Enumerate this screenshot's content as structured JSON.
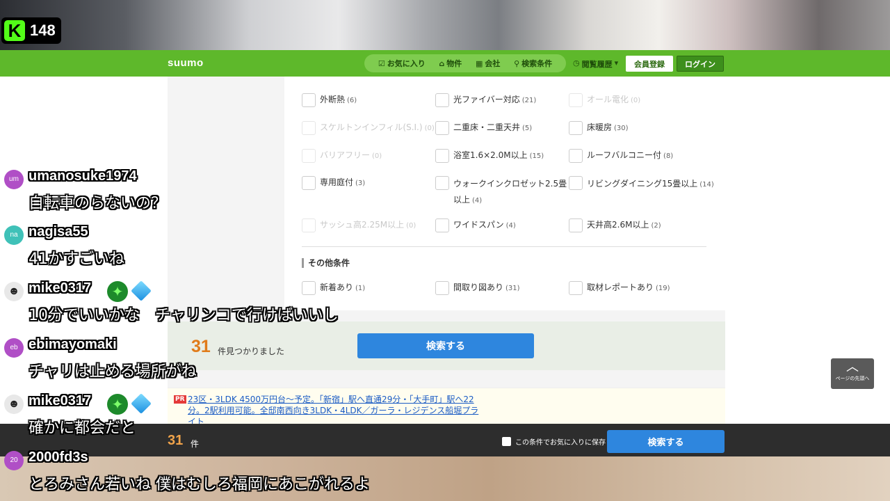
{
  "stream": {
    "platform_logo": "K",
    "viewer_count": "148"
  },
  "header": {
    "logo": "suumo",
    "nav": [
      {
        "icon": "☑",
        "label": "お気に入り"
      },
      {
        "icon": "⌂",
        "label": "物件"
      },
      {
        "icon": "▦",
        "label": "会社"
      },
      {
        "icon": "⚲",
        "label": "検索条件"
      }
    ],
    "history": {
      "icon": "◷",
      "label": "閲覧履歴",
      "caret": "▾"
    },
    "register_label": "会員登録",
    "login_label": "ログイン"
  },
  "features": [
    {
      "label": "外断熱",
      "count": "(6)",
      "disabled": false
    },
    {
      "label": "光ファイバー対応",
      "count": "(21)",
      "disabled": false
    },
    {
      "label": "オール電化",
      "count": "(0)",
      "disabled": true
    },
    {
      "label": "スケルトンインフィル(S.I.)",
      "count": "(0)",
      "disabled": true
    },
    {
      "label": "二重床・二重天井",
      "count": "(5)",
      "disabled": false
    },
    {
      "label": "床暖房",
      "count": "(30)",
      "disabled": false
    },
    {
      "label": "バリアフリー",
      "count": "(0)",
      "disabled": true
    },
    {
      "label": "浴室1.6×2.0M以上",
      "count": "(15)",
      "disabled": false
    },
    {
      "label": "ルーフバルコニー付",
      "count": "(8)",
      "disabled": false
    },
    {
      "label": "専用庭付",
      "count": "(3)",
      "disabled": false
    },
    {
      "label": "ウォークインクロゼット2.5畳以上",
      "count": "(4)",
      "disabled": false
    },
    {
      "label": "リビングダイニング15畳以上",
      "count": "(14)",
      "disabled": false
    },
    {
      "label": "サッシュ高2.25M以上",
      "count": "(0)",
      "disabled": true
    },
    {
      "label": "ワイドスパン",
      "count": "(4)",
      "disabled": false
    },
    {
      "label": "天井高2.6M以上",
      "count": "(2)",
      "disabled": false
    }
  ],
  "other_section": {
    "title": "その他条件",
    "items": [
      {
        "label": "新着あり",
        "count": "(1)",
        "disabled": false
      },
      {
        "label": "間取り図あり",
        "count": "(31)",
        "disabled": false
      },
      {
        "label": "取材レポートあり",
        "count": "(19)",
        "disabled": false
      }
    ]
  },
  "results": {
    "count": "31",
    "found_label": "件見つかりました",
    "search_label": "検索する"
  },
  "pr": {
    "badge": "PR",
    "text": "23区・3LDK 4500万円台～予定。「新宿」駅へ直通29分・「大手町」駅へ22分。2駅利用可能。全邸南西向き3LDK・4LDK／ガーラ・レジデンス船堀プライト"
  },
  "scroll_top": {
    "arrow": "︿",
    "label": "ページの先頭へ"
  },
  "bottom_bar": {
    "count": "31",
    "unit": "件",
    "save_label": "この条件でお気に入りに保存",
    "search_label": "検索する"
  },
  "chat": [
    {
      "avatar": "um",
      "avatar_color": "#b04fc6",
      "user": "umanosuke1974",
      "text": "自転車のらないの？",
      "badges": false
    },
    {
      "avatar": "na",
      "avatar_color": "#3fc1b8",
      "user": "nagisa55",
      "text": "41かすごいね",
      "badges": false
    },
    {
      "avatar": "",
      "avatar_color": "#e8e8e8",
      "user": "mike0317",
      "text": "10分でいいかな　チャリンコで行けばいいし",
      "badges": true
    },
    {
      "avatar": "eb",
      "avatar_color": "#b04fc6",
      "user": "ebimayomaki",
      "text": "チャリは止める場所がね",
      "badges": false
    },
    {
      "avatar": "",
      "avatar_color": "#e8e8e8",
      "user": "mike0317",
      "text": "確かに都会だと",
      "badges": true
    },
    {
      "avatar": "20",
      "avatar_color": "#b04fc6",
      "user": "2000fd3s",
      "text": "とろみさん若いね 僕はむしろ福岡にあこがれるよ",
      "badges": false
    }
  ]
}
